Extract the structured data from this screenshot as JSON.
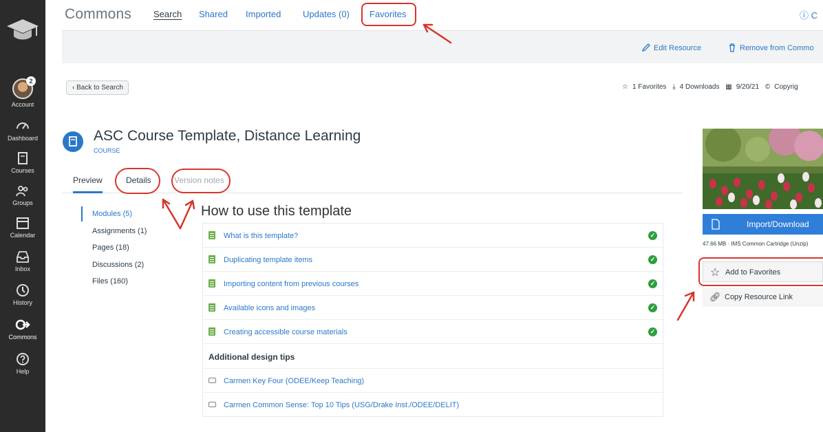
{
  "nav": {
    "items": [
      {
        "label": "Account",
        "icon": "account-avatar",
        "badge": "2"
      },
      {
        "label": "Dashboard",
        "icon": "dashboard-icon"
      },
      {
        "label": "Courses",
        "icon": "courses-icon"
      },
      {
        "label": "Groups",
        "icon": "groups-icon"
      },
      {
        "label": "Calendar",
        "icon": "calendar-icon"
      },
      {
        "label": "Inbox",
        "icon": "inbox-icon"
      },
      {
        "label": "History",
        "icon": "history-icon"
      },
      {
        "label": "Commons",
        "icon": "commons-icon"
      },
      {
        "label": "Help",
        "icon": "help-icon"
      }
    ]
  },
  "header": {
    "brand": "Commons",
    "tabs": [
      {
        "label": "Search",
        "active": true
      },
      {
        "label": "Shared"
      },
      {
        "label": "Imported"
      },
      {
        "label": "Updates (0)"
      },
      {
        "label": "Favorites"
      }
    ],
    "right_text": "ⓘ C"
  },
  "toolbar": {
    "edit": "Edit Resource",
    "remove": "Remove from Commo"
  },
  "back_label": "Back to Search",
  "stats": {
    "favorites": "1 Favorites",
    "downloads": "4 Downloads",
    "date": "9/20/21",
    "copyright": "Copyrig"
  },
  "resource": {
    "title": "ASC Course Template, Distance Learning",
    "type": "COURSE"
  },
  "detail_tabs": [
    {
      "label": "Preview",
      "active": true
    },
    {
      "label": "Details"
    },
    {
      "label": "Version notes"
    }
  ],
  "sidebar": [
    {
      "label": "Modules (5)",
      "active": true
    },
    {
      "label": "Assignments (1)"
    },
    {
      "label": "Pages (18)"
    },
    {
      "label": "Discussions (2)"
    },
    {
      "label": "Files (160)"
    }
  ],
  "module": {
    "title": "How to use this template",
    "items": [
      "What is this template?",
      "Duplicating template items",
      "Importing content from previous courses",
      "Available icons and images",
      "Creating accessible course materials"
    ],
    "subheading": "Additional design tips",
    "links": [
      "Carmen Key Four (ODEE/Keep Teaching)",
      "Carmen Common Sense: Top 10 Tips (USG/Drake Inst./ODEE/DELIT)"
    ]
  },
  "panel": {
    "import": "Import/Download",
    "file_info": "47.66 MB · IMS Common Cartridge (Unzip)",
    "favorite": "Add to Favorites",
    "copy_link": "Copy Resource Link"
  },
  "colors": {
    "accent": "#2a78c7",
    "nav_bg": "#2b2b2b",
    "annotation": "#d6362c",
    "check": "#2f9e3f"
  }
}
